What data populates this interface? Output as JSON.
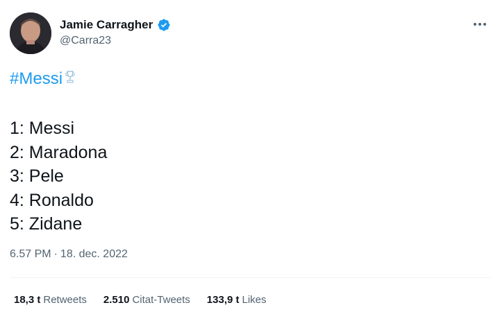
{
  "author": {
    "display_name": "Jamie Carragher",
    "handle": "@Carra23",
    "verified": true,
    "verified_color": "#1d9bf0"
  },
  "tweet": {
    "hashtag": "#Messi",
    "ranking": [
      "1: Messi",
      "2: Maradona",
      "3: Pele",
      "4: Ronaldo",
      "5: Zidane"
    ],
    "time": "6.57 PM",
    "date": "18. dec. 2022"
  },
  "stats": {
    "retweets": {
      "value": "18,3 t",
      "label": "Retweets"
    },
    "quote_tweets": {
      "value": "2.510",
      "label": "Citat-Tweets"
    },
    "likes": {
      "value": "133,9 t",
      "label": "Likes"
    }
  },
  "icons": {
    "more": "more-horizontal-icon",
    "verified": "verified-badge-icon",
    "hashflag": "world-cup-trophy-icon"
  },
  "colors": {
    "link": "#1d9bf0",
    "text": "#0f1419",
    "secondary": "#536471"
  }
}
